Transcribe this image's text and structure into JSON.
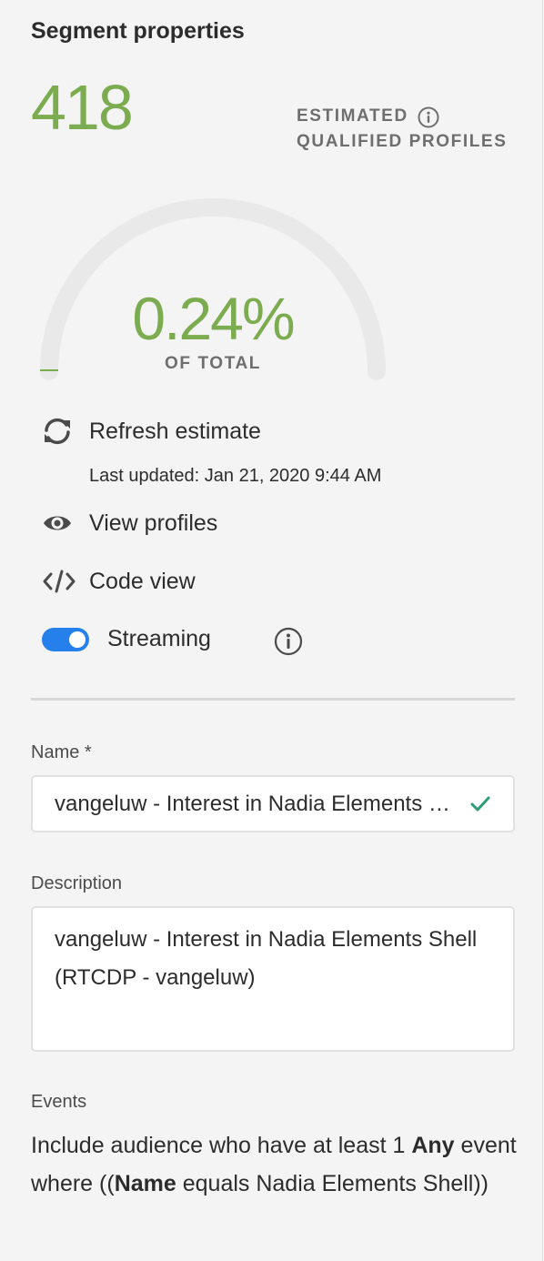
{
  "panel": {
    "title": "Segment properties",
    "qualified_count": "418",
    "estimated_label_1": "ESTIMATED",
    "estimated_label_2": "QUALIFIED PROFILES",
    "percent": "0.24%",
    "percent_fraction": 0.0024,
    "of_total": "OF TOTAL",
    "accent_color": "#7cac50"
  },
  "actions": {
    "refresh_label": "Refresh estimate",
    "last_updated": "Last updated: Jan 21, 2020 9:44 AM",
    "view_profiles_label": "View profiles",
    "code_view_label": "Code view",
    "streaming_label": "Streaming",
    "streaming_enabled": true
  },
  "form": {
    "name_label": "Name *",
    "name_value": "vangeluw - Interest in Nadia Elements Shell",
    "description_label": "Description",
    "description_value": "vangeluw - Interest in Nadia Elements Shell  (RTCDP - vangeluw)"
  },
  "events": {
    "label": "Events",
    "text_1": "Include audience who have at least 1 ",
    "bold_1": "Any",
    "text_2": " event where ((",
    "bold_2": "Name",
    "text_3": " equals Nadia Elements Shell))"
  }
}
